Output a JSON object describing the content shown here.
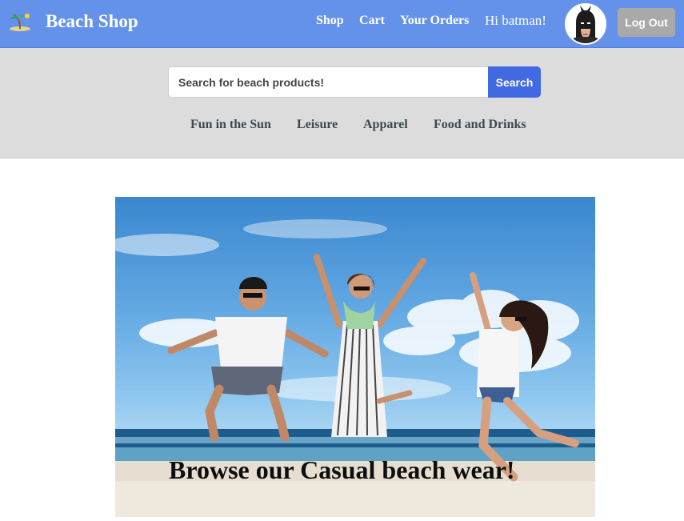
{
  "header": {
    "brand": "Beach Shop",
    "logo_icon": "beach-island-icon",
    "nav": [
      {
        "label": "Shop"
      },
      {
        "label": "Cart"
      },
      {
        "label": "Your Orders"
      }
    ],
    "greeting": "Hi batman!",
    "avatar_icon": "batman-avatar",
    "logout_label": "Log Out",
    "colors": {
      "navbar": "#6492ea",
      "logout": "#a9a9a9"
    }
  },
  "search": {
    "placeholder": "Search for beach products!",
    "value": "",
    "button_label": "Search",
    "button_color": "#4169e1"
  },
  "categories": [
    {
      "label": "Fun in the Sun"
    },
    {
      "label": "Leisure"
    },
    {
      "label": "Apparel"
    },
    {
      "label": "Food and Drinks"
    }
  ],
  "hero": {
    "caption": "Browse our Casual beach wear!",
    "image": "people-jumping-on-beach-photo"
  }
}
